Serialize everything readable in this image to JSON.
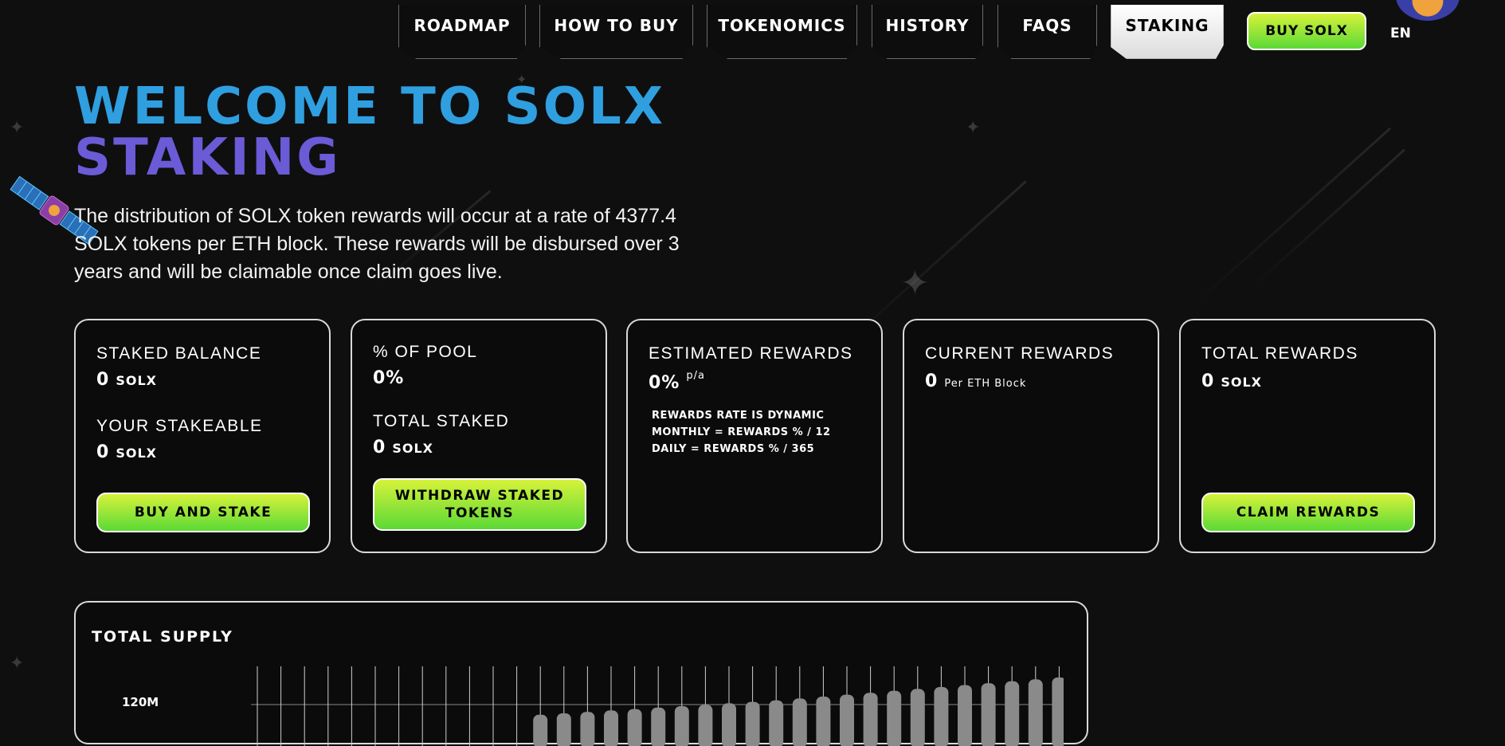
{
  "nav": {
    "tabs": [
      {
        "label": "ROADMAP",
        "active": false
      },
      {
        "label": "HOW TO BUY",
        "active": false
      },
      {
        "label": "TOKENOMICS",
        "active": false
      },
      {
        "label": "HISTORY",
        "active": false
      },
      {
        "label": "FAQS",
        "active": false
      },
      {
        "label": "STAKING",
        "active": true
      }
    ],
    "buy_label": "BUY SOLX",
    "language": "EN"
  },
  "hero": {
    "title_line1": "WELCOME TO SOLX",
    "title_line2": "STAKING",
    "description": "The distribution of SOLX token rewards will occur at a rate of 4377.4 SOLX tokens per ETH block. These rewards will be disbursed over 3 years and will be claimable once claim goes live."
  },
  "cards": {
    "staked_balance": {
      "label": "STAKED BALANCE",
      "value": "0",
      "unit": "SOLX"
    },
    "stakeable": {
      "label": "YOUR STAKEABLE",
      "value": "0",
      "unit": "SOLX"
    },
    "buy_and_stake": "BUY AND STAKE",
    "pool": {
      "label": "% OF POOL",
      "value": "0%"
    },
    "total_staked": {
      "label": "TOTAL STAKED",
      "value": "0",
      "unit": "SOLX"
    },
    "withdraw": "WITHDRAW STAKED TOKENS",
    "estimated": {
      "label": "ESTIMATED REWARDS",
      "value": "0%",
      "suffix": "p/a",
      "note": [
        "REWARDS RATE IS DYNAMIC",
        "MONTHLY = REWARDS % / 12",
        "DAILY = REWARDS % / 365"
      ]
    },
    "current": {
      "label": "CURRENT REWARDS",
      "value": "0",
      "unit": "Per ETH Block"
    },
    "total": {
      "label": "TOTAL REWARDS",
      "value": "0",
      "unit": "SOLX"
    },
    "claim": "CLAIM REWARDS"
  },
  "supply": {
    "title": "TOTAL SUPPLY",
    "tick": "120M",
    "bar_levels": [
      0,
      0,
      0,
      0,
      0,
      0,
      0,
      0,
      0,
      0,
      0,
      0,
      0.02,
      0.05,
      0.08,
      0.11,
      0.14,
      0.17,
      0.2,
      0.23,
      0.26,
      0.29,
      0.32,
      0.36,
      0.4,
      0.44,
      0.48,
      0.52,
      0.56,
      0.6,
      0.64,
      0.68,
      0.72,
      0.76,
      0.8,
      0.84,
      0.88
    ]
  },
  "colors": {
    "title_blue": "#2f9fe0",
    "title_purple": "#6b5bd6",
    "button_green_top": "#d6f23a",
    "button_green_bottom": "#5bd936",
    "background": "#0f0f10"
  }
}
